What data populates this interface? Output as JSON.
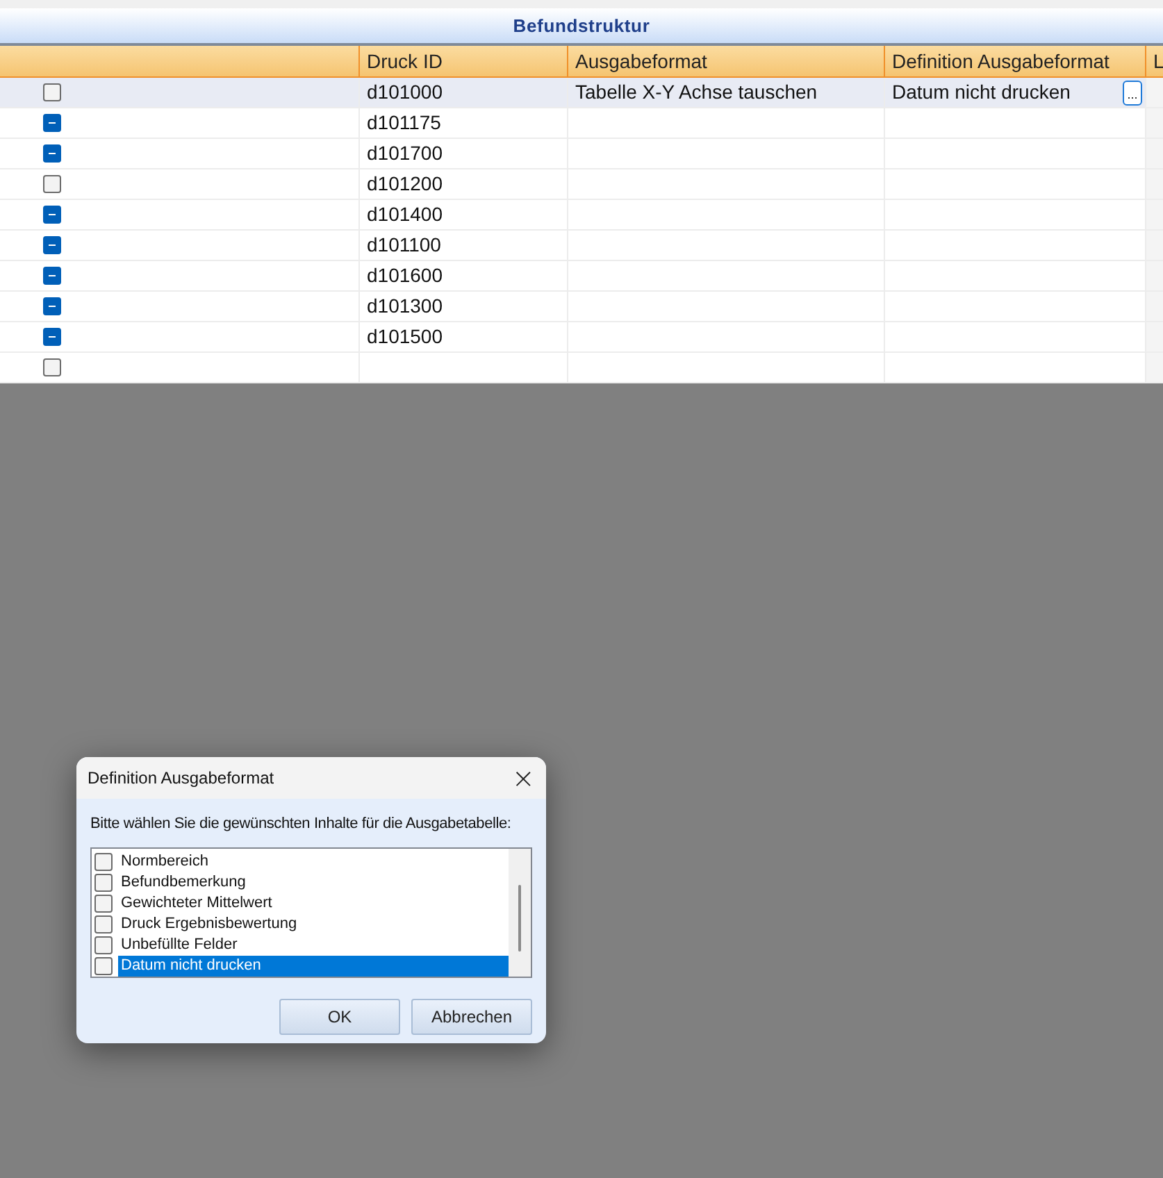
{
  "panel": {
    "title": "Befundstruktur"
  },
  "table": {
    "columns": [
      "",
      "Druck ID",
      "Ausgabeformat",
      "Definition Ausgabeformat",
      "L"
    ],
    "rows": [
      {
        "checked": false,
        "selected": true,
        "druck_id": "d101000",
        "ausgabeformat": "Tabelle X-Y Achse tauschen",
        "definition": "Datum nicht drucken",
        "edit_button": "..."
      },
      {
        "checked": true,
        "selected": false,
        "druck_id": "d101175"
      },
      {
        "checked": true,
        "selected": false,
        "druck_id": "d101700"
      },
      {
        "checked": false,
        "selected": false,
        "druck_id": "d101200"
      },
      {
        "checked": true,
        "selected": false,
        "druck_id": "d101400"
      },
      {
        "checked": true,
        "selected": false,
        "druck_id": "d101100"
      },
      {
        "checked": true,
        "selected": false,
        "druck_id": "d101600"
      },
      {
        "checked": true,
        "selected": false,
        "druck_id": "d101300"
      },
      {
        "checked": true,
        "selected": false,
        "druck_id": "d101500"
      },
      {
        "checked": false,
        "selected": false
      }
    ]
  },
  "dialog": {
    "title": "Definition Ausgabeformat",
    "close": "×",
    "prompt": "Bitte wählen Sie die gewünschten Inhalte für die Ausgabetabelle:",
    "items": [
      {
        "label": "Normbereich",
        "checked": false,
        "selected": false
      },
      {
        "label": "Befundbemerkung",
        "checked": false,
        "selected": false
      },
      {
        "label": "Gewichteter Mittelwert",
        "checked": false,
        "selected": false
      },
      {
        "label": "Druck Ergebnisbewertung",
        "checked": false,
        "selected": false
      },
      {
        "label": "Unbefüllte Felder",
        "checked": false,
        "selected": false
      },
      {
        "label": "Datum nicht drucken",
        "checked": false,
        "selected": true
      }
    ],
    "buttons": [
      "OK",
      "Abbrechen"
    ]
  }
}
